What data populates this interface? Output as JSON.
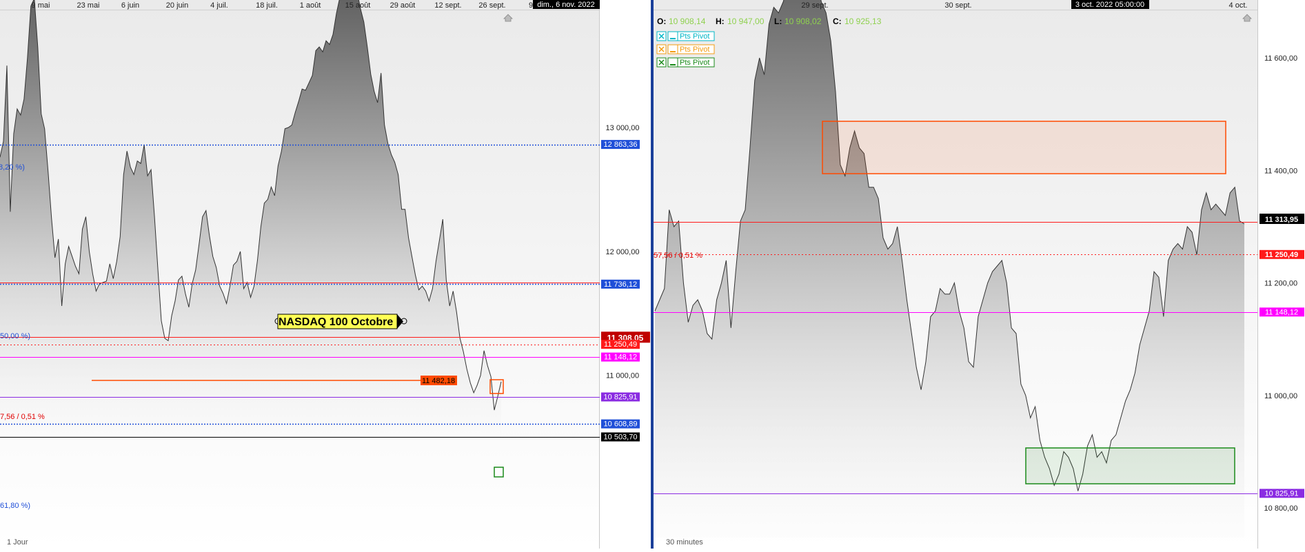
{
  "left_panel": {
    "date_axis_labels": [
      "9 mai",
      "23 mai",
      "6 juin",
      "20 juin",
      "4 juil.",
      "18 juil.",
      "1 août",
      "15 août",
      "29 août",
      "12 sept.",
      "26 sept.",
      "9"
    ],
    "crosshair_date": "dim., 6 nov. 2022",
    "timeframe": "1 Jour",
    "price_labels": [
      "13 000,00",
      "12 000,00",
      "11 000,00"
    ],
    "chart_title": "NASDAQ 100  Octobre",
    "fib_labels": [
      "8,20 %)",
      "50,00 %)",
      "61,80 %)"
    ],
    "pivot_label": "7,56 / 0,51 %",
    "level_tags": [
      {
        "text": "12 863,36",
        "bg": "#1f4fd8"
      },
      {
        "text": "11 736,12",
        "bg": "#1f4fd8"
      },
      {
        "text": "11 482,18",
        "bg": "#ff4a00"
      },
      {
        "text": "11 308,05",
        "bg": "#c00000"
      },
      {
        "text": "11 250,49",
        "bg": "#ff1a1a"
      },
      {
        "text": "11 148,12",
        "bg": "#ff00ff"
      },
      {
        "text": "10 825,91",
        "bg": "#8a2be2"
      },
      {
        "text": "10 608,89",
        "bg": "#1f4fd8"
      },
      {
        "text": "10 503,70",
        "bg": "#000000"
      }
    ]
  },
  "right_panel": {
    "date_axis_labels": [
      "29 sept.",
      "30 sept.",
      "4 oct."
    ],
    "crosshair_date": "3 oct. 2022 05:00:00",
    "timeframe": "30 minutes",
    "ohlc": [
      {
        "key": "O:",
        "value": "10 908,14"
      },
      {
        "key": "H:",
        "value": "10 947,00"
      },
      {
        "key": "L:",
        "value": "10 908,02"
      },
      {
        "key": "C:",
        "value": "10 925,13"
      }
    ],
    "legend": [
      {
        "text": "Pts Pivot",
        "color": "#00b7c7"
      },
      {
        "text": "Pts Pivot",
        "color": "#f39c12"
      },
      {
        "text": "Pts Pivot",
        "color": "#1a8a1a"
      }
    ],
    "price_labels": [
      "11 600,00",
      "11 400,00",
      "11 200,00",
      "11 000,00",
      "10 800,00"
    ],
    "pivot_label": "57,56 / 0,51 %",
    "level_tags": [
      {
        "text": "11 313,95",
        "bg": "#000000"
      },
      {
        "text": "11 250,49",
        "bg": "#ff1a1a"
      },
      {
        "text": "11 148,12",
        "bg": "#ff00ff"
      },
      {
        "text": "10 825,91",
        "bg": "#8a2be2"
      }
    ]
  },
  "chart_data": [
    {
      "type": "area",
      "timeframe": "1 Jour",
      "title": "NASDAQ 100  Octobre",
      "ylim": [
        10350,
        13500
      ],
      "values": [
        12760,
        12890,
        13500,
        12320,
        12950,
        13150,
        13100,
        13230,
        13560,
        13980,
        14040,
        13650,
        13110,
        12990,
        12650,
        12270,
        11950,
        12100,
        11560,
        11900,
        12040,
        11960,
        11880,
        11820,
        12180,
        12280,
        12000,
        11820,
        11680,
        11740,
        11750,
        11760,
        11900,
        11780,
        11920,
        12120,
        12620,
        12810,
        12680,
        12620,
        12730,
        12710,
        12860,
        12610,
        12660,
        12280,
        11850,
        11440,
        11300,
        11280,
        11480,
        11600,
        11770,
        11800,
        11660,
        11550,
        11740,
        11850,
        12060,
        12280,
        12330,
        12130,
        11960,
        11870,
        11720,
        11660,
        11580,
        11720,
        11890,
        11920,
        12000,
        11700,
        11750,
        11630,
        11720,
        11930,
        12200,
        12390,
        12420,
        12520,
        12450,
        12690,
        12810,
        12990,
        13000,
        13020,
        13120,
        13210,
        13310,
        13300,
        13360,
        13420,
        13620,
        13650,
        13610,
        13700,
        13670,
        13750,
        13920,
        14050,
        14200,
        14180,
        14080,
        14150,
        14100,
        13960,
        13850,
        13650,
        13430,
        13290,
        13200,
        13440,
        13020,
        12870,
        12780,
        12720,
        12620,
        12340,
        12340,
        12110,
        11960,
        11810,
        11690,
        11720,
        11680,
        11600,
        11700,
        11920,
        12090,
        12260,
        11770,
        11560,
        11680,
        11510,
        11300,
        11190,
        11050,
        10940,
        10860,
        10920,
        11000,
        11200,
        11080,
        10990,
        10720,
        10830,
        10950
      ],
      "levels": [
        {
          "name": "fib 38,20 %",
          "value": 12863.36
        },
        {
          "name": "fib 50,00 %",
          "value": 11736.12
        },
        {
          "name": "horizontal",
          "value": 11482.18
        },
        {
          "name": "last",
          "value": 11308.05
        },
        {
          "name": "pivot",
          "value": 11250.49
        },
        {
          "name": "support",
          "value": 11148.12
        },
        {
          "name": "support",
          "value": 10825.91
        },
        {
          "name": "fib 61,80 %",
          "value": 10608.89
        },
        {
          "name": "low",
          "value": 10503.7
        }
      ]
    },
    {
      "type": "area",
      "timeframe": "30 minutes",
      "ylim": [
        10750,
        11700
      ],
      "x": [
        "29 sept.",
        "30 sept.",
        "4 oct."
      ],
      "values": [
        11150,
        11170,
        11190,
        11330,
        11300,
        11310,
        11200,
        11130,
        11160,
        11170,
        11150,
        11110,
        11100,
        11170,
        11200,
        11240,
        11120,
        11220,
        11310,
        11330,
        11440,
        11560,
        11600,
        11570,
        11660,
        11690,
        11680,
        11700,
        11730,
        11760,
        11800,
        11790,
        11730,
        11760,
        11750,
        11700,
        11680,
        11630,
        11540,
        11410,
        11390,
        11440,
        11470,
        11440,
        11430,
        11370,
        11370,
        11350,
        11280,
        11260,
        11270,
        11300,
        11240,
        11170,
        11110,
        11050,
        11010,
        11060,
        11140,
        11150,
        11190,
        11180,
        11180,
        11200,
        11150,
        11120,
        11060,
        11050,
        11140,
        11170,
        11200,
        11220,
        11230,
        11240,
        11200,
        11120,
        11110,
        11020,
        11000,
        10960,
        10980,
        10920,
        10890,
        10870,
        10840,
        10860,
        10900,
        10890,
        10870,
        10830,
        10860,
        10910,
        10930,
        10890,
        10900,
        10880,
        10920,
        10930,
        10960,
        10990,
        11010,
        11040,
        11090,
        11120,
        11150,
        11220,
        11210,
        11140,
        11240,
        11260,
        11270,
        11260,
        11300,
        11290,
        11250,
        11330,
        11360,
        11330,
        11340,
        11330,
        11320,
        11360,
        11370,
        11310,
        11305
      ]
    }
  ]
}
